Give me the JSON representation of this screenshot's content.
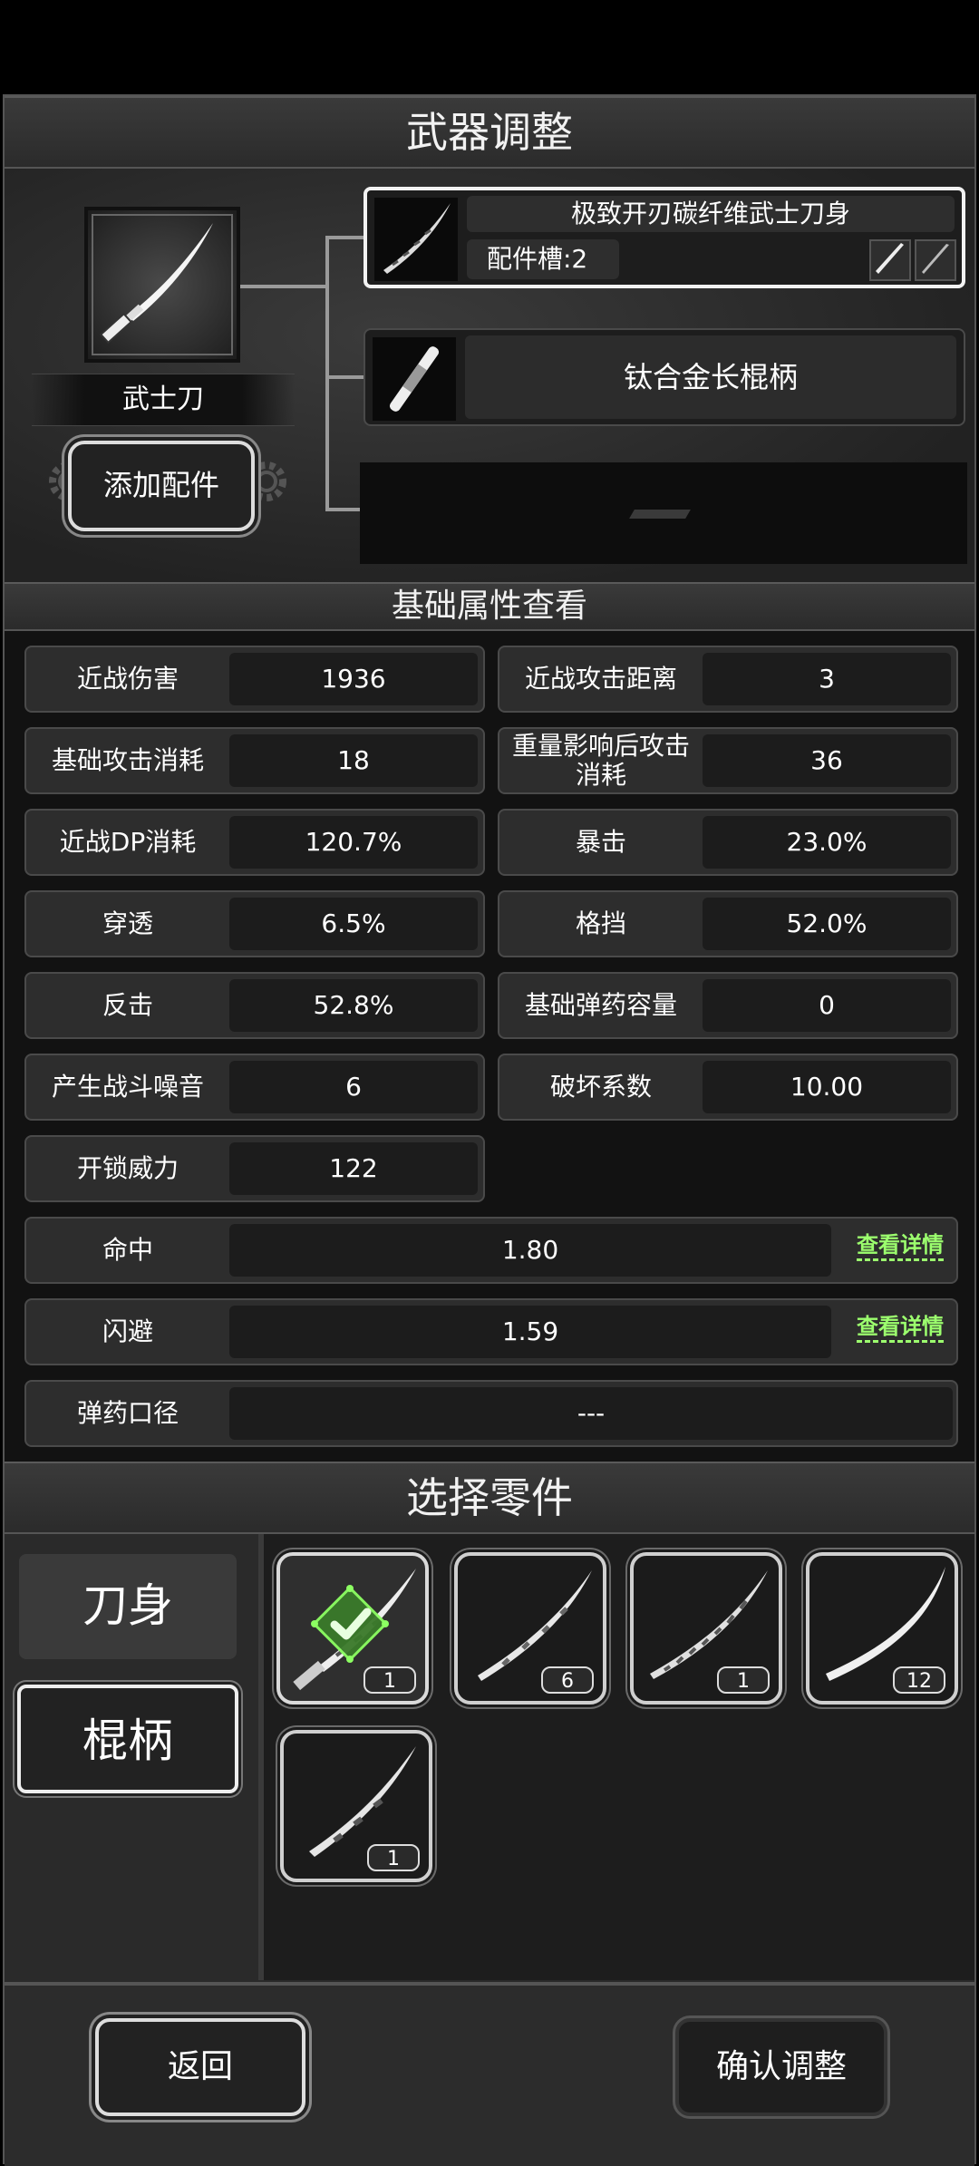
{
  "title": "武器调整",
  "weapon": {
    "name": "武士刀",
    "add_button": "添加配件"
  },
  "slots": [
    {
      "name": "极致开刃碳纤维武士刀身",
      "sockets_label": "配件槽:2"
    },
    {
      "name": "钛合金长棍柄"
    }
  ],
  "stats_header": "基础属性查看",
  "stats": [
    {
      "label": "近战伤害",
      "value": "1936"
    },
    {
      "label": "近战攻击距离",
      "value": "3"
    },
    {
      "label": "基础攻击消耗",
      "value": "18"
    },
    {
      "label": "重量影响后攻击消耗",
      "value": "36"
    },
    {
      "label": "近战DP消耗",
      "value": "120.7%"
    },
    {
      "label": "暴击",
      "value": "23.0%"
    },
    {
      "label": "穿透",
      "value": "6.5%"
    },
    {
      "label": "格挡",
      "value": "52.0%"
    },
    {
      "label": "反击",
      "value": "52.8%"
    },
    {
      "label": "基础弹药容量",
      "value": "0"
    },
    {
      "label": "产生战斗噪音",
      "value": "6"
    },
    {
      "label": "破坏系数",
      "value": "10.00"
    },
    {
      "label": "开锁威力",
      "value": "122"
    }
  ],
  "wide_stats": [
    {
      "label": "命中",
      "value": "1.80",
      "link": "查看详情"
    },
    {
      "label": "闪避",
      "value": "1.59",
      "link": "查看详情"
    },
    {
      "label": "弹药口径",
      "value": "---"
    }
  ],
  "parts_header": "选择零件",
  "part_tabs": [
    "刀身",
    "棍柄"
  ],
  "parts": [
    {
      "count": "1",
      "selected": true
    },
    {
      "count": "6",
      "selected": false
    },
    {
      "count": "1",
      "selected": false
    },
    {
      "count": "12",
      "selected": false
    },
    {
      "count": "1",
      "selected": false
    }
  ],
  "footer": {
    "back": "返回",
    "confirm": "确认调整"
  },
  "colors": {
    "accent_green": "#9cff6e",
    "selected_check": "#3dbb2a"
  }
}
